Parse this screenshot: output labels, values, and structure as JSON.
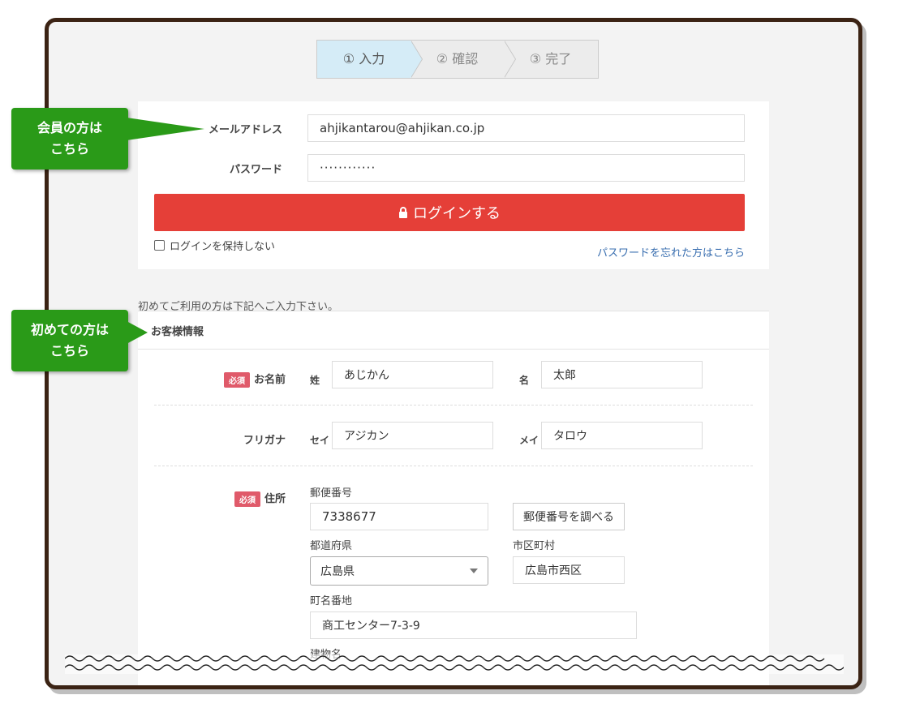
{
  "steps": [
    {
      "label": "① 入力",
      "active": true
    },
    {
      "label": "② 確認",
      "active": false
    },
    {
      "label": "③ 完了",
      "active": false
    }
  ],
  "callouts": {
    "member": {
      "line1": "会員の方は",
      "line2": "こちら"
    },
    "first_time": {
      "line1": "初めての方は",
      "line2": "こちら"
    }
  },
  "login": {
    "email_label": "メールアドレス",
    "email_value": "ahjikantarou@ahjikan.co.jp",
    "password_label": "パスワード",
    "password_value": "············",
    "login_button": "ログインする",
    "keep_login_label": "ログインを保持しない",
    "forgot_link": "パスワードを忘れた方はこちら"
  },
  "intro_text": "初めてご利用の方は下記へご入力下さい。",
  "customer": {
    "section_title": "お客様情報",
    "required_badge": "必須",
    "name_label": "お名前",
    "sei_label": "姓",
    "sei_value": "あじかん",
    "mei_label": "名",
    "mei_value": "太郎",
    "furigana_label": "フリガナ",
    "sei_kana_label": "セイ",
    "sei_kana_value": "アジカン",
    "mei_kana_label": "メイ",
    "mei_kana_value": "タロウ",
    "address_label": "住所",
    "zip_label": "郵便番号",
    "zip_value": "7338677",
    "zip_button": "郵便番号を調べる",
    "pref_label": "都道府県",
    "pref_value": "広島県",
    "city_label": "市区町村",
    "city_value": "広島市西区",
    "town_label": "町名番地",
    "town_value": "商工センター7-3-9",
    "building_label": "建物名"
  },
  "colors": {
    "frame_border": "#3b2314",
    "login_button": "#e53f38",
    "callout_green": "#2a9a18",
    "required_badge": "#e05a6a",
    "link": "#3a6fb0",
    "active_step": "#d5ecf7"
  }
}
